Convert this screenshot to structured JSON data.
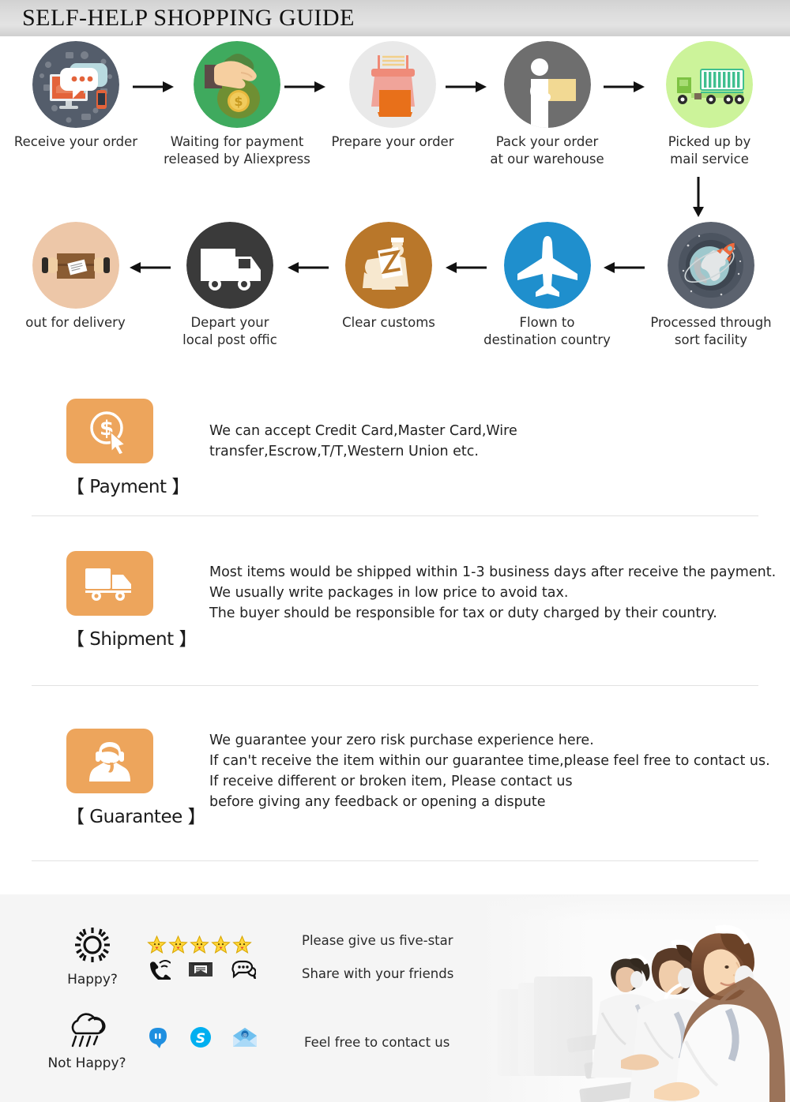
{
  "header": {
    "title": "SELF-HELP SHOPPING GUIDE",
    "bg_color": "#d8d8d8"
  },
  "flow": {
    "row1": [
      {
        "label_line1": "Receive your order",
        "label_line2": "",
        "icon": "computer-chat-icon",
        "circle_color": "#545d6b"
      },
      {
        "label_line1": "Waiting for payment",
        "label_line2": "released by Aliexpress",
        "icon": "hand-money-bag-icon",
        "circle_color": "#3faa5e"
      },
      {
        "label_line1": "Prepare your order",
        "label_line2": "",
        "icon": "packing-table-icon",
        "circle_color": "#e8e8e8"
      },
      {
        "label_line1": "Pack your order",
        "label_line2": "at our warehouse",
        "icon": "worker-parcel-icon",
        "circle_color": "#6e6e6e"
      },
      {
        "label_line1": "Picked up by",
        "label_line2": "mail service",
        "icon": "cargo-truck-icon",
        "circle_color": "#ccf39a"
      }
    ],
    "row2": [
      {
        "label_line1": "out for delivery",
        "label_line2": "",
        "icon": "parcel-handover-icon",
        "circle_color": "#edc7a8"
      },
      {
        "label_line1": "Depart your",
        "label_line2": "local post offic",
        "icon": "delivery-van-icon",
        "circle_color": "#3a3a3a"
      },
      {
        "label_line1": "Clear customs",
        "label_line2": "",
        "icon": "customs-officer-icon",
        "circle_color": "#b9772a"
      },
      {
        "label_line1": "Flown to",
        "label_line2": "destination country",
        "icon": "airplane-icon",
        "circle_color": "#1f8fcd"
      },
      {
        "label_line1": "Processed through",
        "label_line2": "sort facility",
        "icon": "globe-rocket-icon",
        "circle_color": "#5b626e"
      }
    ]
  },
  "sections": [
    {
      "caption": "【 Payment 】",
      "icon": "dollar-coin-click-icon",
      "icon_color": "#eda55c",
      "lines": [
        "We can accept Credit Card,Master Card,Wire",
        "transfer,Escrow,T/T,Western Union etc."
      ]
    },
    {
      "caption": "【 Shipment 】",
      "icon": "shipping-truck-icon",
      "icon_color": "#eda55c",
      "lines": [
        "Most items would be shipped within 1-3 business days after receive the payment.",
        "We usually write packages in low price to avoid tax.",
        "The buyer should be responsible for tax or duty charged by their country."
      ]
    },
    {
      "caption": "【 Guarantee 】",
      "icon": "support-agent-icon",
      "icon_color": "#eda55c",
      "lines": [
        "We guarantee your zero risk purchase experience here.",
        "If can't receive the item within our guarantee time,please feel free to contact us.",
        "If receive different or broken item, Please contact us",
        "before giving any feedback or opening a dispute"
      ]
    }
  ],
  "footer": {
    "bg_color": "#f5f5f5",
    "happy": {
      "mood_label": "Happy?",
      "mood_icon": "sun-icon",
      "star_count": 5,
      "star_color": "#ffd63a",
      "icons": [
        "phone-ringing-icon",
        "envelope-mail-icon",
        "chat-bubble-icon"
      ],
      "text_line1": "Please give us five-star",
      "text_line2": "Share with your friends"
    },
    "not_happy": {
      "mood_label": "Not Happy?",
      "mood_icon": "rain-cloud-icon",
      "icons": [
        "aliwangwang-icon",
        "skype-icon",
        "email-envelope-icon"
      ],
      "text_line1": "Feel free to contact us"
    },
    "photo_alt": "call-center-agents-photo"
  }
}
